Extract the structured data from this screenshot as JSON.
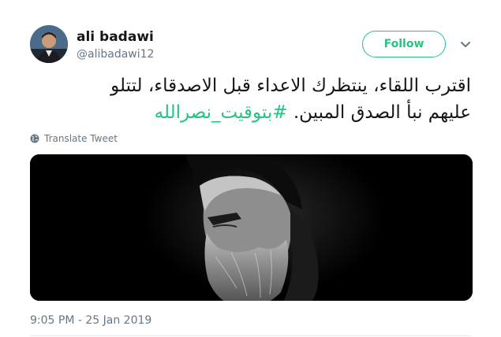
{
  "user": {
    "display_name": "ali badawi",
    "handle": "@alibadawi12",
    "follow_label": "Follow"
  },
  "tweet": {
    "text_line1": "اقترب اللقاء، ينتظرك الاعداء قبل الاصدقاء، لتتلو",
    "text_line2": "عليهم نبأ الصدق المبين.",
    "hashtag": "#بتوقيت_نصرالله",
    "translate_label": "Translate Tweet",
    "timestamp": "9:05 PM - 25 Jan 2019"
  },
  "icons": {
    "avatar": "profile-photo",
    "menu": "chevron-down-icon",
    "translate": "globe-icon"
  },
  "colors": {
    "accent": "#26c281",
    "text_primary": "#14171a",
    "text_secondary": "#657786",
    "media_background": "#000000"
  }
}
